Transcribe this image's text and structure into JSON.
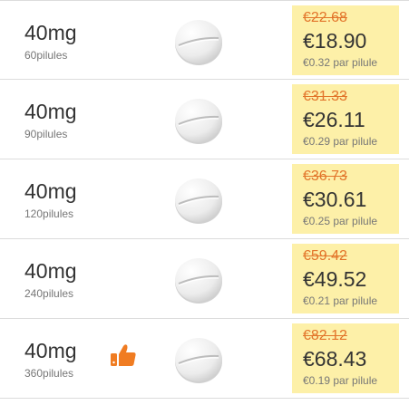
{
  "offers": [
    {
      "dose": "40mg",
      "quantity": "60pilules",
      "old_price": "€22.68",
      "price": "€18.90",
      "per_pill": "€0.32 par pilule",
      "icon": "pill-icon"
    },
    {
      "dose": "40mg",
      "quantity": "90pilules",
      "old_price": "€31.33",
      "price": "€26.11",
      "per_pill": "€0.29 par pilule",
      "icon": "pill-icon"
    },
    {
      "dose": "40mg",
      "quantity": "120pilules",
      "old_price": "€36.73",
      "price": "€30.61",
      "per_pill": "€0.25 par pilule",
      "icon": "pill-icon"
    },
    {
      "dose": "40mg",
      "quantity": "240pilules",
      "old_price": "€59.42",
      "price": "€49.52",
      "per_pill": "€0.21 par pilule",
      "icon": "pill-icon"
    },
    {
      "dose": "40mg",
      "quantity": "360pilules",
      "old_price": "€82.12",
      "price": "€68.43",
      "per_pill": "€0.19 par pilule",
      "icon": "pill-icon",
      "badge_icon": "thumbs-up-icon"
    }
  ],
  "colors": {
    "price_box": "#fdf0a8",
    "old_price": "#e2742a",
    "thumbs_up": "#f07c22",
    "divider": "#dcdcdc"
  }
}
